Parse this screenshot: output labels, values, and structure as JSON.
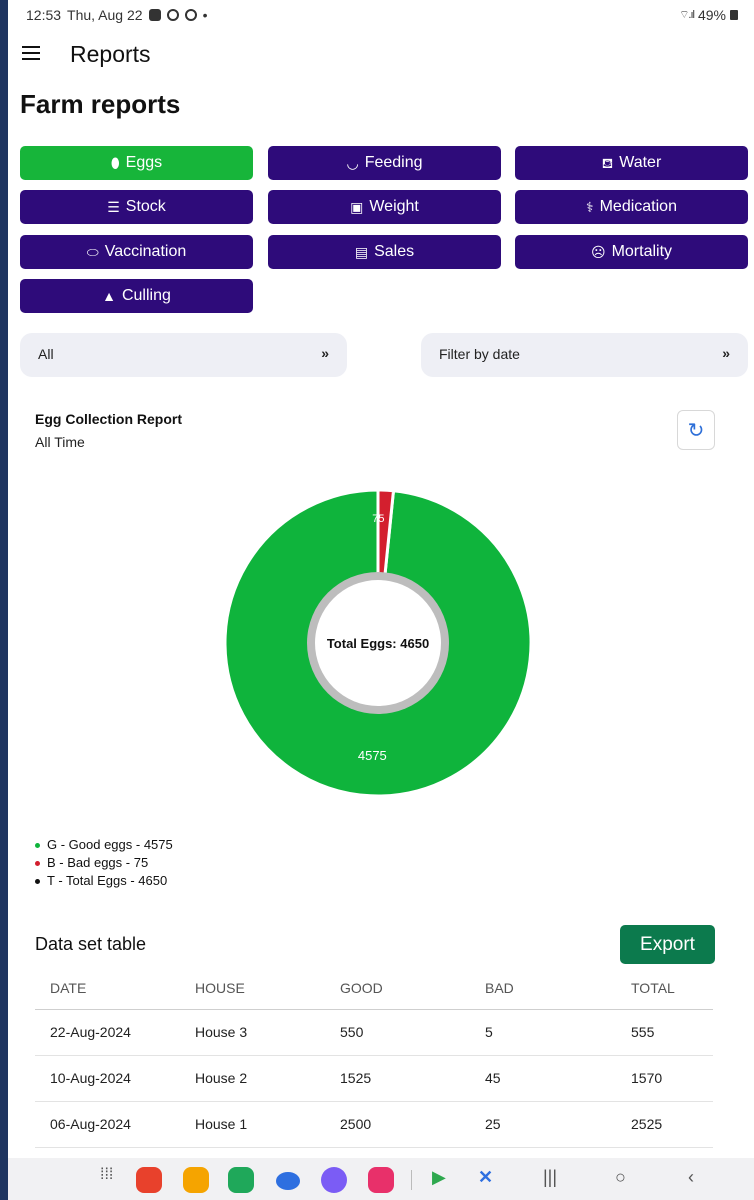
{
  "status": {
    "time": "12:53",
    "date": "Thu, Aug 22",
    "battery": "49%"
  },
  "app_bar": {
    "title": "Reports"
  },
  "page": {
    "title": "Farm reports"
  },
  "report_types": [
    {
      "label": "Eggs",
      "icon": "egg-icon",
      "active": true
    },
    {
      "label": "Feeding",
      "icon": "bowl-icon"
    },
    {
      "label": "Water",
      "icon": "watering-can-icon"
    },
    {
      "label": "Stock",
      "icon": "database-icon"
    },
    {
      "label": "Weight",
      "icon": "scale-icon"
    },
    {
      "label": "Medication",
      "icon": "pills-icon"
    },
    {
      "label": "Vaccination",
      "icon": "capsule-icon"
    },
    {
      "label": "Sales",
      "icon": "cash-icon"
    },
    {
      "label": "Mortality",
      "icon": "sad-face-icon"
    },
    {
      "label": "Culling",
      "icon": "warning-icon"
    }
  ],
  "filters": {
    "house": "All",
    "date": "Filter by date"
  },
  "report": {
    "title": "Egg Collection Report",
    "period": "All Time"
  },
  "chart_data": {
    "type": "pie",
    "variant": "donut",
    "center_label": "Total Eggs: 4650",
    "slices": [
      {
        "label": "G",
        "name": "Good eggs",
        "value": 4575,
        "color": "#0fb43c"
      },
      {
        "label": "B",
        "name": "Bad eggs",
        "value": 75,
        "color": "#d31f2e"
      }
    ],
    "data_labels": [
      "4575",
      "75"
    ],
    "legend": [
      {
        "text": "G - Good eggs - 4575",
        "color": "#0fb43c"
      },
      {
        "text": "B - Bad eggs - 75",
        "color": "#d31f2e"
      },
      {
        "text": "T - Total Eggs - 4650",
        "color": "#111111"
      }
    ]
  },
  "table": {
    "title": "Data set table",
    "export_label": "Export",
    "columns": [
      "DATE",
      "HOUSE",
      "GOOD",
      "BAD",
      "TOTAL"
    ],
    "rows": [
      [
        "22-Aug-2024",
        "House 3",
        "550",
        "5",
        "555"
      ],
      [
        "10-Aug-2024",
        "House 2",
        "1525",
        "45",
        "1570"
      ],
      [
        "06-Aug-2024",
        "House 1",
        "2500",
        "25",
        "2525"
      ]
    ]
  },
  "colors": {
    "primary": "#2e0b7a",
    "active": "#17b53a",
    "export": "#0c7a4d"
  }
}
